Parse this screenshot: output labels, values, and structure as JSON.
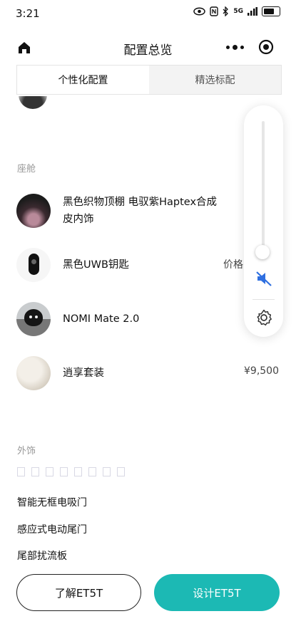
{
  "status_bar": {
    "time": "3:21",
    "signal_text": "5G",
    "icons": [
      "eye-icon",
      "nfc-icon",
      "bluetooth-icon",
      "signal-icon",
      "battery-icon"
    ]
  },
  "nav": {
    "title": "配置总览",
    "home_icon": "home-icon",
    "more_icon": "more-dots-icon",
    "close_icon": "target-icon"
  },
  "tabs": [
    {
      "label": "个性化配置",
      "active": true
    },
    {
      "label": "精选标配",
      "active": false
    }
  ],
  "sections": {
    "cabin_title": "座舱",
    "exterior_title": "外饰"
  },
  "cabin_items": [
    {
      "label_line1": "黑色织物顶棚 电驭紫Haptex合成",
      "label_line2": "皮内饰",
      "price": ""
    },
    {
      "label_line1": "黑色UWB钥匙",
      "price": "价格"
    },
    {
      "label_line1": "NOMI Mate 2.0",
      "price": ""
    },
    {
      "label_line1": "逍享套装",
      "price": "¥9,500"
    }
  ],
  "exterior_items": [
    "智能无框电吸门",
    "感应式电动尾门",
    "尾部扰流板"
  ],
  "floating_panel": {
    "icons": [
      "volume-slider",
      "mute-icon",
      "settings-gear-icon"
    ],
    "volume_level": 0.1
  },
  "actions": {
    "learn_label": "了解ET5T",
    "design_label": "设计ET5T"
  },
  "colors": {
    "accent": "#1cb9b4",
    "tab_inactive_bg": "#f3f3f3",
    "section_gray": "#999999",
    "mute_blue": "#2f6fe0"
  }
}
